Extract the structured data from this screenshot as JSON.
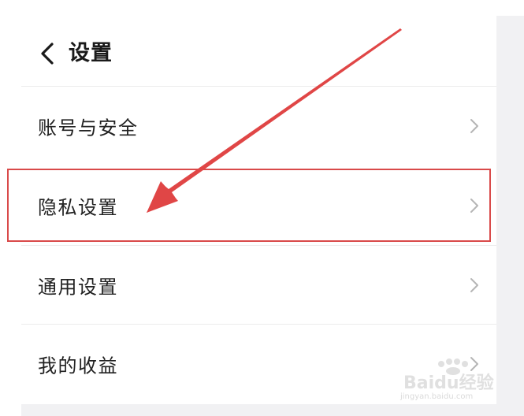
{
  "header": {
    "title": "设置",
    "back_icon": "chevron-left-icon"
  },
  "menu": {
    "items": [
      {
        "label": "账号与安全",
        "icon": "chevron-right-icon"
      },
      {
        "label": "隐私设置",
        "icon": "chevron-right-icon",
        "highlighted": true
      },
      {
        "label": "通用设置",
        "icon": "chevron-right-icon"
      },
      {
        "label": "我的收益",
        "icon": "chevron-right-icon"
      }
    ]
  },
  "annotation": {
    "color": "#d94a4a",
    "target": "隐私设置"
  },
  "watermark": {
    "brand": "Baidu经验",
    "url": "jingyan.baidu.com"
  },
  "colors": {
    "text": "#222222",
    "chevron": "#b5b5b5",
    "background": "#f1f1f3"
  }
}
